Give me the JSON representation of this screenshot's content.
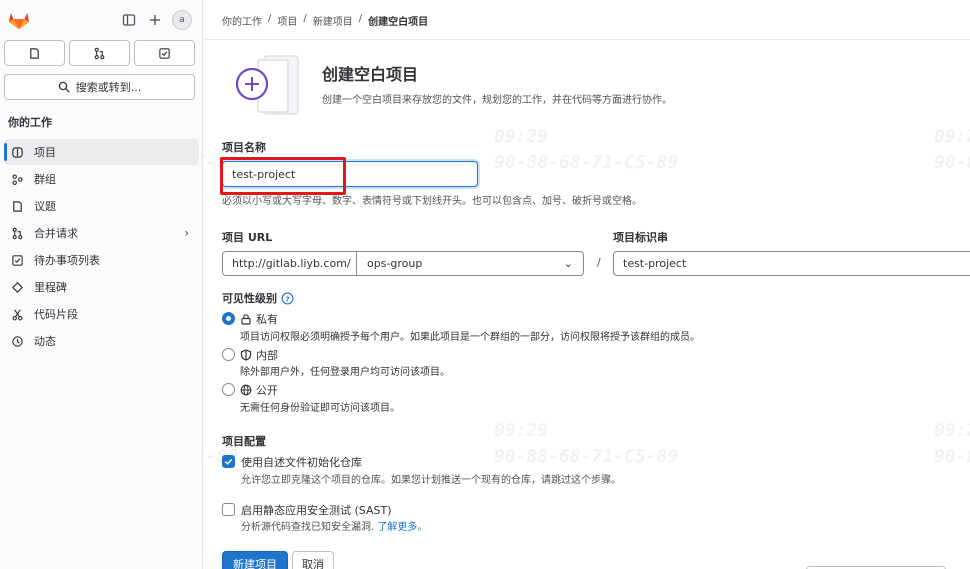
{
  "sidebar": {
    "avatar_text": "a",
    "search_label": "搜索或转到...",
    "heading": "你的工作",
    "items": [
      {
        "label": "项目",
        "icon": "project-icon"
      },
      {
        "label": "群组",
        "icon": "group-icon"
      },
      {
        "label": "议题",
        "icon": "issues-icon"
      },
      {
        "label": "合并请求",
        "icon": "merge-request-icon"
      },
      {
        "label": "待办事项列表",
        "icon": "todo-icon"
      },
      {
        "label": "里程碑",
        "icon": "milestone-icon"
      },
      {
        "label": "代码片段",
        "icon": "snippet-icon"
      },
      {
        "label": "动态",
        "icon": "activity-icon"
      }
    ]
  },
  "breadcrumb": [
    "你的工作",
    "项目",
    "新建项目",
    "创建空白项目"
  ],
  "header": {
    "title": "创建空白项目",
    "description": "创建一个空白项目来存放您的文件，规划您的工作，并在代码等方面进行协作。"
  },
  "form": {
    "name_label": "项目名称",
    "name_value": "test-project",
    "name_help": "必须以小写或大写字母、数字、表情符号或下划线开头。也可以包含点、加号、破折号或空格。",
    "url_label": "项目 URL",
    "url_prefix": "http://gitlab.liyb.com/",
    "namespace": "ops-group",
    "slash": "/",
    "slug_label": "项目标识串",
    "slug_value": "test-project",
    "visibility_label": "可见性级别",
    "visibility": [
      {
        "label": "私有",
        "desc": "项目访问权限必须明确授予每个用户。如果此项目是一个群组的一部分，访问权限将授予该群组的成员。",
        "checked": true
      },
      {
        "label": "内部",
        "desc": "除外部用户外，任何登录用户均可访问该项目。",
        "checked": false
      },
      {
        "label": "公开",
        "desc": "无需任何身份验证即可访问该项目。",
        "checked": false
      }
    ],
    "config_label": "项目配置",
    "readme_label": "使用自述文件初始化仓库",
    "readme_desc": "允许您立即克隆这个项目的仓库。如果您计划推送一个现有的仓库，请跳过这个步骤。",
    "readme_checked": true,
    "sast_label": "启用静态应用安全测试 (SAST)",
    "sast_desc": "分析源代码查找已知安全漏洞.",
    "sast_link": "了解更多。",
    "sast_checked": false
  },
  "actions": {
    "create": "新建项目",
    "cancel": "取消"
  },
  "watermark": {
    "time": "09:29",
    "code": "90-88-68-71-C5-89"
  },
  "colors": {
    "accent": "#1f75cb",
    "highlight": "#e3161b",
    "logo": "#e24329"
  }
}
